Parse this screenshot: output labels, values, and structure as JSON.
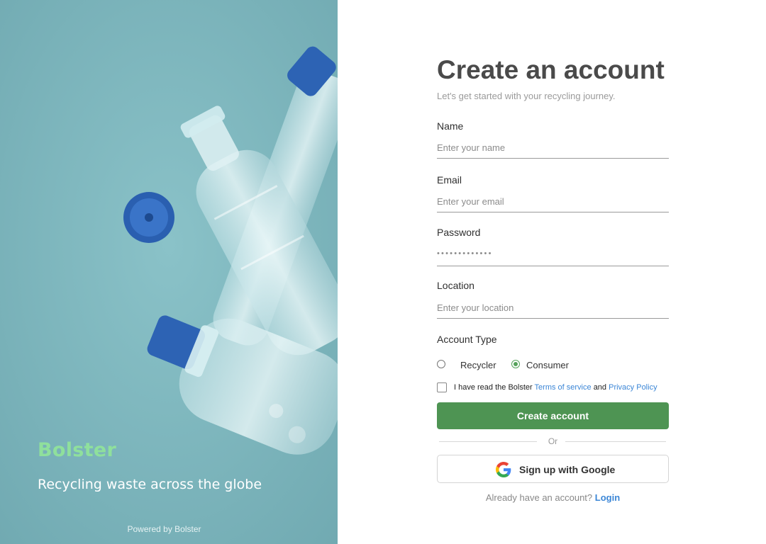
{
  "hero": {
    "brand": "Bolster",
    "tagline": "Recycling waste across the globe",
    "powered_by": "Powered by Bolster",
    "colors": {
      "background": "#7db6bd",
      "brand": "#8fe09c",
      "bottle_cap": "#2d63b4"
    }
  },
  "form": {
    "title": "Create an account",
    "subtitle": "Let's get started with your recycling journey.",
    "name": {
      "label": "Name",
      "placeholder": "Enter your name"
    },
    "email": {
      "label": "Email",
      "placeholder": "Enter your email"
    },
    "password": {
      "label": "Password",
      "masked_value": "•••••••••••••"
    },
    "location": {
      "label": "Location",
      "placeholder": "Enter your location"
    },
    "account_type": {
      "label": "Account Type",
      "options": [
        "Recycler",
        "Consumer"
      ],
      "selected": "Consumer"
    },
    "terms": {
      "prefix": "I have read the Bolster",
      "terms_link": "Terms of service",
      "conjunction": "and",
      "privacy_link": "Privacy Policy"
    },
    "create_button": "Create account",
    "or_text": "Or",
    "google_button": "Sign up with Google",
    "login_prompt": "Already have an account?",
    "login_link": "Login"
  },
  "colors": {
    "primary": "#4e9453",
    "link": "#3b86d6",
    "title": "#4a4a4a"
  }
}
